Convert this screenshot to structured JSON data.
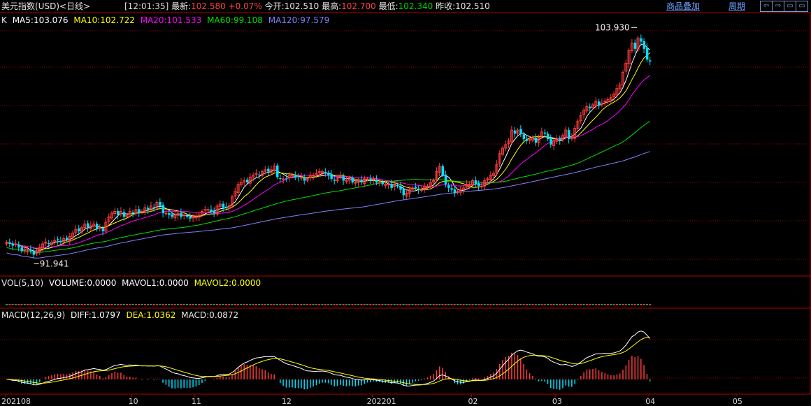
{
  "header": {
    "title": "美元指数(USD)<日线>",
    "time": "[12:01:35]",
    "latest_label": "最新:",
    "latest_value": "102.580",
    "change": "+0.07%",
    "open_label": "今开:",
    "open_value": "102.510",
    "high_label": "最高:",
    "high_value": "102.700",
    "low_label": "最低:",
    "low_value": "102.340",
    "prev_label": "昨收:",
    "prev_value": "102.510",
    "overlay_link": "商品叠加",
    "period_link": "周期",
    "tool_buttons": [
      "⇦",
      "⇨",
      "▭",
      "▭"
    ]
  },
  "colors": {
    "up": "#ff3c3c",
    "down": "#00e0ff",
    "ma5": "#ffffff",
    "ma10": "#ffff00",
    "ma20": "#ff00ff",
    "ma60": "#00e000",
    "ma120": "#8080ff",
    "grid": "#8b0000",
    "diff": "#ffffff",
    "dea": "#ffff00"
  },
  "price_panel": {
    "prefix": "K",
    "ma_labels": [
      "MA5:103.076",
      "MA10:102.722",
      "MA20:101.533",
      "MA60:99.108",
      "MA120:97.579"
    ],
    "max_label": "103.930",
    "min_label": "91.941"
  },
  "volume_panel": {
    "labels": [
      "VOL(5,10)",
      "VOLUME:0.0000",
      "MAVOL1:0.0000",
      "MAVOL2:0.0000"
    ]
  },
  "macd_panel": {
    "labels": [
      "MACD(12,26,9)",
      "DIFF:1.0797",
      "DEA:1.0362",
      "MACD:0.0872"
    ]
  },
  "x_axis": {
    "ticks": [
      {
        "label": "202108",
        "index": 0
      },
      {
        "label": "10",
        "index": 42
      },
      {
        "label": "11",
        "index": 63
      },
      {
        "label": "12",
        "index": 93
      },
      {
        "label": "202201",
        "index": 122
      },
      {
        "label": "02",
        "index": 155
      },
      {
        "label": "03",
        "index": 183
      },
      {
        "label": "04",
        "index": 214
      },
      {
        "label": "05",
        "index": 243
      }
    ]
  },
  "chart_data": {
    "type": "candlestick",
    "ylim": [
      91.3,
      104.3
    ],
    "closes": [
      92.6,
      92.5,
      92.4,
      92.5,
      92.3,
      92.1,
      92.2,
      92.2,
      92.1,
      91.9,
      92.1,
      92.3,
      92.5,
      92.6,
      92.5,
      92.6,
      92.7,
      92.7,
      92.6,
      92.8,
      92.7,
      92.9,
      93.1,
      93.3,
      93.2,
      93.4,
      93.6,
      93.4,
      93.5,
      93.6,
      93.3,
      93.4,
      93.2,
      93.7,
      94.0,
      94.2,
      94.3,
      94.1,
      94.3,
      94.0,
      94.1,
      94.3,
      94.2,
      94.4,
      94.2,
      94.3,
      94.5,
      94.4,
      94.6,
      94.5,
      94.8,
      94.6,
      94.2,
      94.2,
      94.1,
      94.0,
      94.1,
      94.2,
      94.0,
      94.1,
      94.0,
      93.9,
      94.0,
      94.0,
      94.1,
      94.3,
      94.4,
      94.4,
      94.3,
      94.2,
      94.6,
      94.7,
      94.5,
      94.5,
      94.6,
      95.1,
      95.4,
      95.8,
      95.9,
      96.0,
      95.9,
      96.2,
      96.3,
      96.4,
      96.3,
      96.5,
      96.6,
      96.5,
      96.6,
      96.8,
      96.2,
      96.1,
      96.1,
      96.1,
      96.3,
      96.3,
      96.2,
      96.2,
      96.2,
      96.0,
      96.1,
      96.3,
      96.3,
      96.4,
      96.5,
      96.5,
      96.4,
      96.3,
      96.1,
      96.0,
      96.2,
      96.3,
      96.0,
      96.0,
      96.1,
      95.9,
      95.9,
      96.0,
      95.9,
      96.1,
      96.1,
      96.0,
      96.1,
      95.9,
      95.9,
      95.8,
      95.8,
      95.8,
      95.6,
      95.8,
      95.7,
      95.5,
      95.2,
      95.3,
      95.5,
      95.6,
      95.6,
      95.5,
      95.5,
      95.7,
      95.7,
      95.9,
      96.0,
      96.5,
      96.8,
      96.3,
      95.8,
      95.6,
      95.5,
      95.3,
      95.4,
      95.5,
      95.6,
      95.8,
      95.8,
      96.0,
      95.8,
      95.7,
      95.7,
      96.0,
      96.1,
      96.3,
      96.4,
      96.9,
      97.5,
      97.8,
      98.0,
      98.2,
      98.8,
      98.6,
      98.8,
      98.6,
      98.3,
      98.2,
      98.3,
      98.4,
      98.1,
      98.4,
      98.7,
      98.6,
      98.3,
      98.0,
      98.2,
      98.3,
      98.2,
      98.5,
      98.8,
      98.3,
      98.4,
      98.9,
      99.3,
      99.6,
      99.9,
      100.1,
      100.0,
      100.2,
      100.4,
      100.2,
      100.3,
      100.4,
      100.5,
      100.6,
      100.8,
      101.1,
      101.3,
      102.0,
      102.5,
      103.2,
      103.6,
      103.3,
      103.9,
      103.7,
      103.3,
      102.7,
      102.6
    ]
  }
}
